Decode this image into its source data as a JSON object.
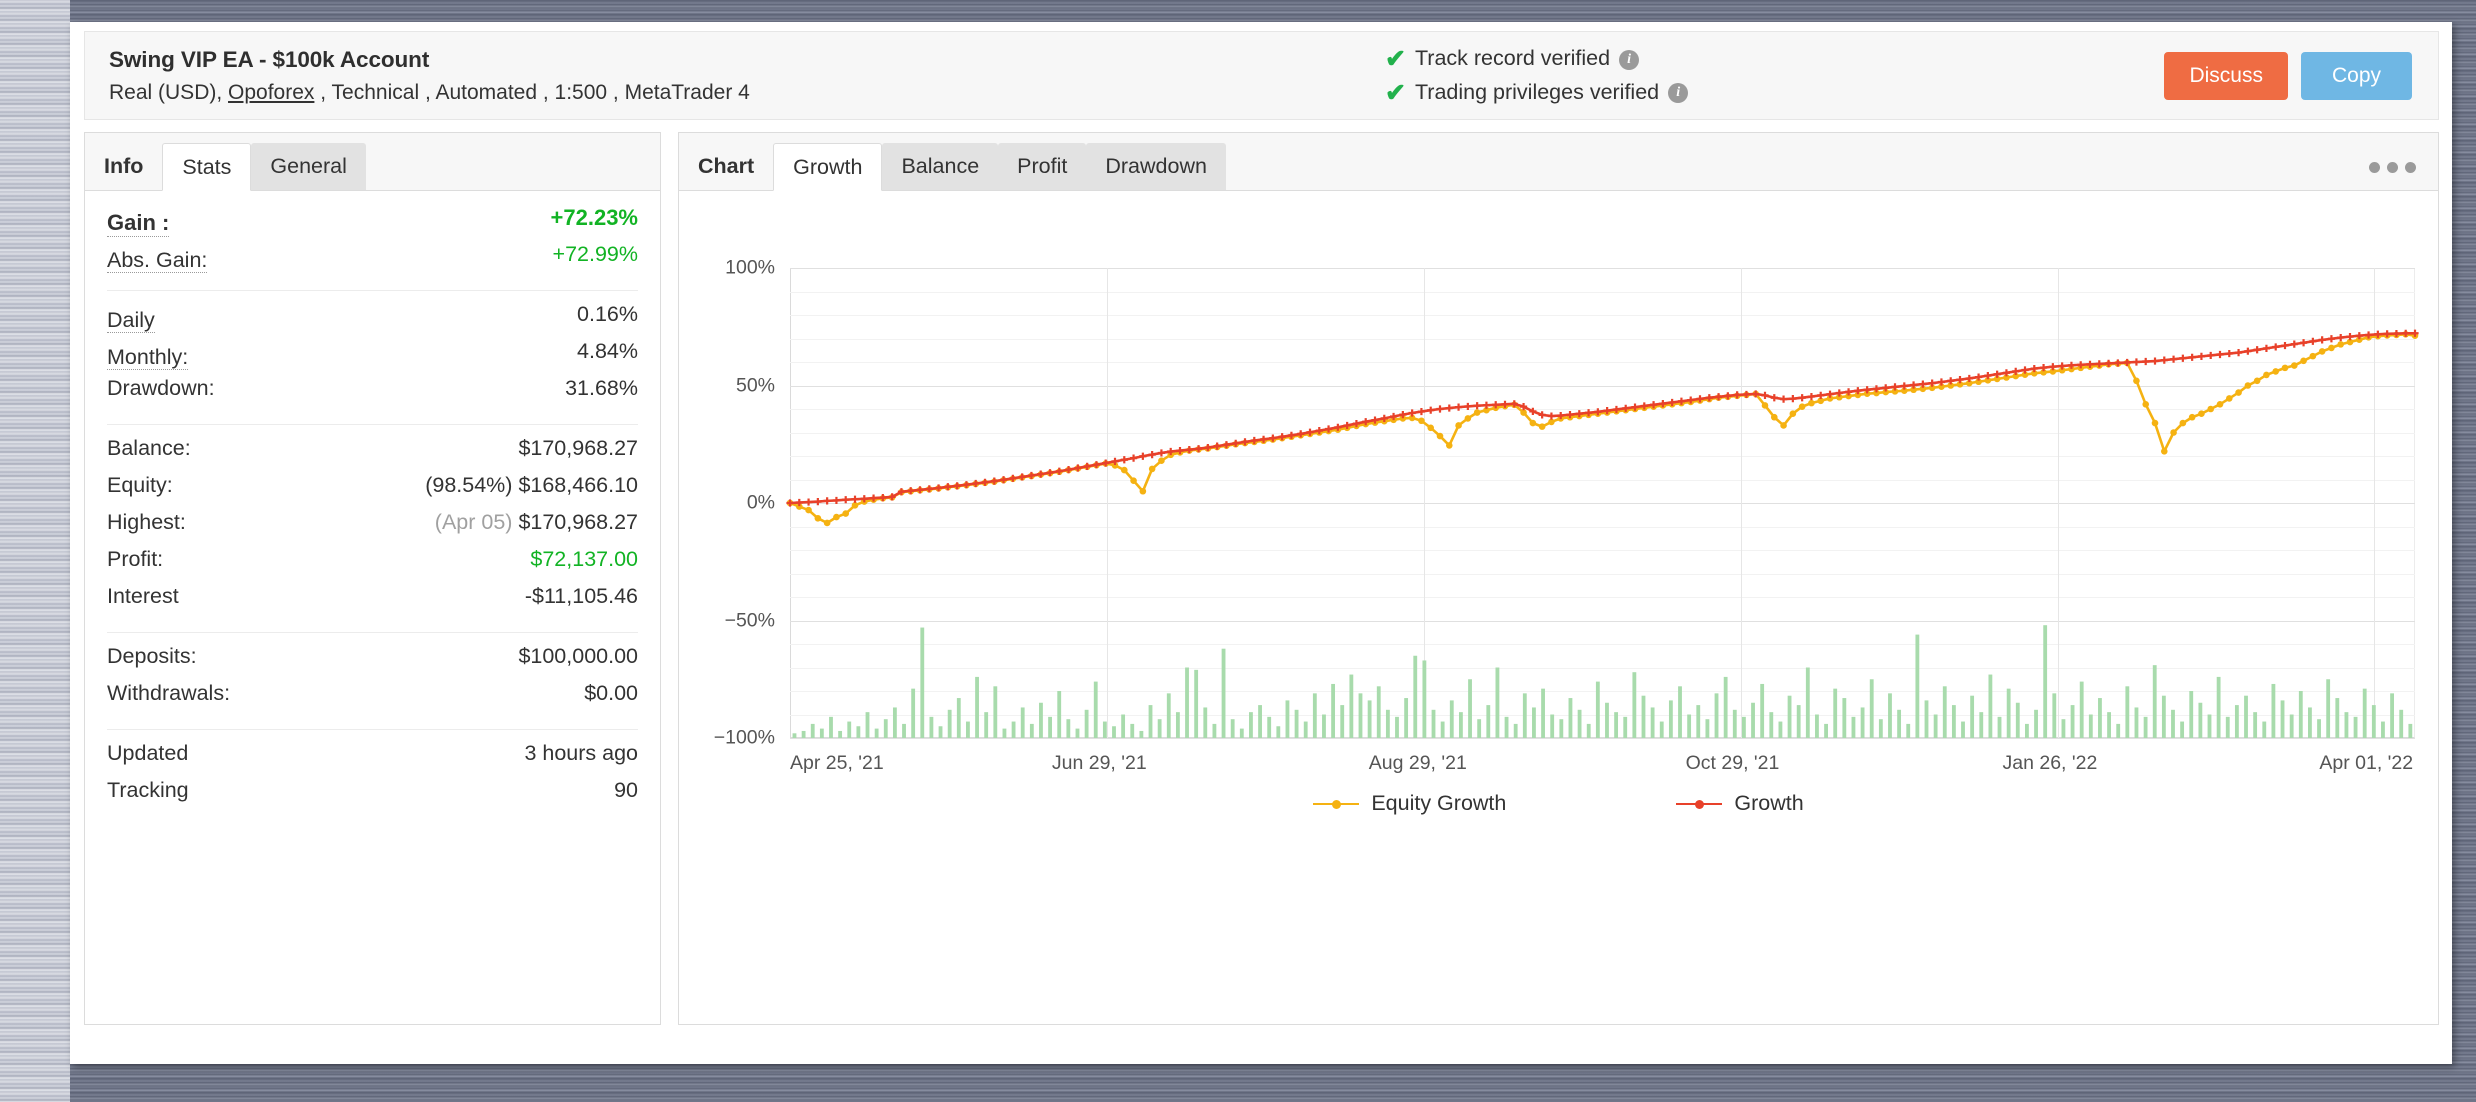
{
  "colors": {
    "growth_line": "#e8412a",
    "equity_line": "#f5b212",
    "volume_bar": "#a8dbac",
    "positive": "#12b324",
    "discuss_btn": "#ef6c43",
    "copy_btn": "#6fb7e4",
    "check_green": "#22b14c"
  },
  "header": {
    "account_title": "Swing VIP EA - $100k Account",
    "meta_prefix": "Real (USD),",
    "broker": "Opoforex",
    "meta_suffix": ", Technical , Automated , 1:500 , MetaTrader 4",
    "verifications": [
      {
        "label": "Track record verified",
        "info": "i"
      },
      {
        "label": "Trading privileges verified",
        "info": "i"
      }
    ],
    "buttons": {
      "discuss": "Discuss",
      "copy": "Copy"
    }
  },
  "stats_panel": {
    "tabs": [
      {
        "label": "Info",
        "state": "bold"
      },
      {
        "label": "Stats",
        "state": "active"
      },
      {
        "label": "General",
        "state": "inactive"
      }
    ],
    "groups": [
      {
        "rows": [
          {
            "label": "Gain :",
            "value": "+72.23%",
            "style": "big-green",
            "hint": "dotted"
          },
          {
            "label": "Abs. Gain:",
            "value": "+72.99%",
            "style": "green",
            "hint": "dotted"
          }
        ]
      },
      {
        "rows": [
          {
            "label": "Daily",
            "value": "0.16%",
            "hint": "dotted"
          },
          {
            "label": "Monthly:",
            "value": "4.84%",
            "hint": "dotted"
          },
          {
            "label": "Drawdown:",
            "value": "31.68%"
          }
        ]
      },
      {
        "rows": [
          {
            "label": "Balance:",
            "value": "$170,968.27"
          },
          {
            "label": "Equity:",
            "value": "$168,466.10",
            "prefix": "(98.54%)"
          },
          {
            "label": "Highest:",
            "value": "$170,968.27",
            "prefix": "(Apr 05)",
            "prefix_muted": true
          },
          {
            "label": "Profit:",
            "value": "$72,137.00",
            "style": "green"
          },
          {
            "label": "Interest",
            "value": "-$11,105.46"
          }
        ]
      },
      {
        "rows": [
          {
            "label": "Deposits:",
            "value": "$100,000.00"
          },
          {
            "label": "Withdrawals:",
            "value": "$0.00"
          }
        ]
      },
      {
        "rows": [
          {
            "label": "Updated",
            "value": "3 hours ago"
          },
          {
            "label": "Tracking",
            "value": "90"
          }
        ]
      }
    ]
  },
  "chart_panel": {
    "tabs": [
      {
        "label": "Chart",
        "state": "bold"
      },
      {
        "label": "Growth",
        "state": "active"
      },
      {
        "label": "Balance",
        "state": "inactive"
      },
      {
        "label": "Profit",
        "state": "inactive"
      },
      {
        "label": "Drawdown",
        "state": "inactive"
      }
    ],
    "menu_icon": "ellipsis-icon"
  },
  "chart_data": {
    "type": "line",
    "title": "",
    "xlabel": "",
    "ylabel": "",
    "ylim": [
      -100,
      100
    ],
    "ytick_labels": [
      "100%",
      "50%",
      "0%",
      "-50%",
      "-100%"
    ],
    "yticks": [
      100,
      50,
      0,
      -50,
      -100
    ],
    "grid": true,
    "grid_step": 10,
    "legend_position": "bottom-center",
    "xtick_labels": [
      "Apr 25, '21",
      "Jun 29, '21",
      "Aug 29, '21",
      "Oct 29, '21",
      "Jan 26, '22",
      "Apr 01, '22"
    ],
    "xtick_positions": [
      0,
      0.195,
      0.39,
      0.585,
      0.78,
      0.975
    ],
    "series": [
      {
        "name": "Growth",
        "color": "#e8412a",
        "marker": "plus",
        "values": [
          0.0,
          0.2,
          0.4,
          0.6,
          0.9,
          1.1,
          1.4,
          1.6,
          1.8,
          2.1,
          2.3,
          2.6,
          4.8,
          5.2,
          5.6,
          6.0,
          6.4,
          6.9,
          7.3,
          7.8,
          8.3,
          8.8,
          9.3,
          9.9,
          10.5,
          11.1,
          11.7,
          12.3,
          12.9,
          13.5,
          14.2,
          14.9,
          15.6,
          16.3,
          17.0,
          17.7,
          18.4,
          19.1,
          19.9,
          20.6,
          21.3,
          21.9,
          22.3,
          22.7,
          23.1,
          23.6,
          24.2,
          24.8,
          25.4,
          26.0,
          26.6,
          27.1,
          27.6,
          28.2,
          28.8,
          29.4,
          30.1,
          30.8,
          31.5,
          32.2,
          33.0,
          33.8,
          34.6,
          35.3,
          36.0,
          36.8,
          37.6,
          38.3,
          38.9,
          39.5,
          40.0,
          40.4,
          40.8,
          41.1,
          41.4,
          41.6,
          41.8,
          42.0,
          42.2,
          41.0,
          39.0,
          37.5,
          37.0,
          37.2,
          37.6,
          38.0,
          38.4,
          38.8,
          39.3,
          39.8,
          40.3,
          40.8,
          41.3,
          41.8,
          42.3,
          42.8,
          43.3,
          43.8,
          44.3,
          44.8,
          45.2,
          45.6,
          46.0,
          46.2,
          46.4,
          45.8,
          44.8,
          44.2,
          44.4,
          44.8,
          45.3,
          45.8,
          46.3,
          46.8,
          47.3,
          47.8,
          48.2,
          48.6,
          49.0,
          49.4,
          49.8,
          50.2,
          50.6,
          51.0,
          51.5,
          52.0,
          52.5,
          53.0,
          53.6,
          54.2,
          54.8,
          55.4,
          56.0,
          56.6,
          57.2,
          57.6,
          58.0,
          58.3,
          58.6,
          58.8,
          59.0,
          59.2,
          59.4,
          59.6,
          59.8,
          60.0,
          60.2,
          60.4,
          60.8,
          61.2,
          61.6,
          62.0,
          62.4,
          62.8,
          63.2,
          63.6,
          64.0,
          64.6,
          65.2,
          65.8,
          66.4,
          67.0,
          67.6,
          68.2,
          68.8,
          69.4,
          69.9,
          70.4,
          70.8,
          71.2,
          71.5,
          71.8,
          72.0,
          72.1,
          72.2,
          72.23
        ]
      },
      {
        "name": "Equity Growth",
        "color": "#f5b212",
        "marker": "circle",
        "values": [
          0.0,
          -1.5,
          -3.0,
          -6.5,
          -8.5,
          -6.0,
          -4.5,
          -1.0,
          0.6,
          1.4,
          2.0,
          2.4,
          4.6,
          5.0,
          5.4,
          5.8,
          6.2,
          6.7,
          7.1,
          7.6,
          8.1,
          8.6,
          9.1,
          9.7,
          10.3,
          10.9,
          11.5,
          12.1,
          12.7,
          13.3,
          14.0,
          14.7,
          15.4,
          16.1,
          16.8,
          16.0,
          14.0,
          9.5,
          5.0,
          14.5,
          18.0,
          20.5,
          21.5,
          22.3,
          22.8,
          23.2,
          23.8,
          24.4,
          25.0,
          25.5,
          26.0,
          26.5,
          27.0,
          27.6,
          28.2,
          28.8,
          29.4,
          30.0,
          30.6,
          31.2,
          32.0,
          32.8,
          33.6,
          34.2,
          34.8,
          35.4,
          36.0,
          36.2,
          35.0,
          32.0,
          28.5,
          24.5,
          33.0,
          36.0,
          38.5,
          39.5,
          40.5,
          41.2,
          41.8,
          38.5,
          34.0,
          32.5,
          34.5,
          36.0,
          36.5,
          37.0,
          37.5,
          38.0,
          38.5,
          39.0,
          39.5,
          40.0,
          40.5,
          41.0,
          41.5,
          42.0,
          42.5,
          43.0,
          43.6,
          44.2,
          44.8,
          45.2,
          45.6,
          46.0,
          46.4,
          41.5,
          36.5,
          33.0,
          38.0,
          41.0,
          42.5,
          43.5,
          44.5,
          45.0,
          45.5,
          46.0,
          46.5,
          46.8,
          47.2,
          47.5,
          47.8,
          48.2,
          48.6,
          49.0,
          49.5,
          50.0,
          50.5,
          51.0,
          51.6,
          52.2,
          52.8,
          53.4,
          54.0,
          54.6,
          55.2,
          55.6,
          56.0,
          56.5,
          57.0,
          57.5,
          58.0,
          58.5,
          59.0,
          59.3,
          59.6,
          52.0,
          42.0,
          34.0,
          22.0,
          30.0,
          34.0,
          36.5,
          38.0,
          40.0,
          42.0,
          44.5,
          47.0,
          50.0,
          52.0,
          54.5,
          56.0,
          57.5,
          58.5,
          60.5,
          62.5,
          64.5,
          66.0,
          67.5,
          68.5,
          69.5,
          70.5,
          71.0,
          71.3,
          71.5,
          71.8,
          71.2
        ]
      }
    ],
    "volume_series": {
      "name": "Volume",
      "color": "#a8dbac",
      "baseline": -100,
      "values": [
        2,
        3,
        6,
        4,
        9,
        3,
        7,
        5,
        11,
        4,
        8,
        13,
        6,
        21,
        47,
        9,
        5,
        12,
        17,
        7,
        26,
        11,
        22,
        4,
        7,
        13,
        6,
        15,
        9,
        20,
        8,
        4,
        12,
        24,
        7,
        5,
        10,
        6,
        3,
        14,
        8,
        19,
        11,
        30,
        29,
        13,
        6,
        38,
        8,
        4,
        11,
        14,
        9,
        5,
        16,
        12,
        7,
        19,
        10,
        23,
        14,
        27,
        19,
        16,
        22,
        12,
        9,
        17,
        35,
        33,
        12,
        7,
        16,
        11,
        25,
        8,
        14,
        30,
        9,
        6,
        19,
        13,
        21,
        10,
        8,
        17,
        12,
        6,
        24,
        15,
        11,
        9,
        28,
        18,
        13,
        7,
        16,
        22,
        10,
        14,
        8,
        19,
        26,
        12,
        9,
        15,
        23,
        11,
        7,
        18,
        14,
        30,
        10,
        6,
        21,
        17,
        9,
        13,
        25,
        8,
        19,
        12,
        6,
        44,
        16,
        10,
        22,
        14,
        7,
        18,
        11,
        27,
        9,
        21,
        15,
        6,
        12,
        48,
        19,
        8,
        14,
        24,
        10,
        17,
        11,
        6,
        22,
        13,
        9,
        31,
        18,
        12,
        7,
        20,
        15,
        10,
        26,
        9,
        14,
        18,
        11,
        7,
        23,
        16,
        10,
        20,
        13,
        8,
        25,
        17,
        11,
        9,
        21,
        14,
        7,
        19,
        12,
        6
      ]
    }
  },
  "legend": [
    {
      "label": "Equity Growth",
      "color": "#f5b212"
    },
    {
      "label": "Growth",
      "color": "#e8412a"
    }
  ]
}
